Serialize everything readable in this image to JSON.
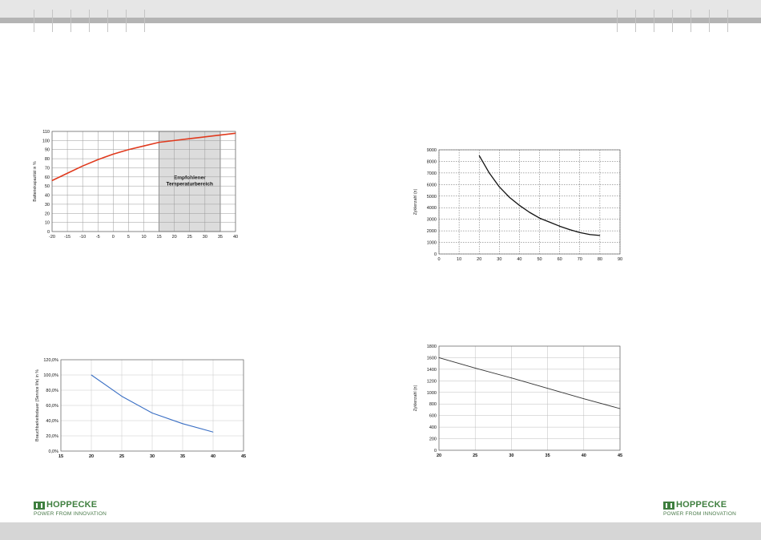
{
  "brand": {
    "logo_name": "HOPPECKE",
    "tagline": "POWER FROM INNOVATION",
    "green": "#3f7f3f"
  },
  "header": {
    "bar_color": "#b4b4b4"
  },
  "chart_data": [
    {
      "id": "capacity-vs-temperature",
      "type": "line",
      "ylabel": "Batteriekapazität in %",
      "xlim": [
        -20,
        40
      ],
      "ylim": [
        0,
        110
      ],
      "xticks": [
        "-20",
        "-15",
        "-10",
        "-5",
        "0",
        "5",
        "10",
        "15",
        "20",
        "25",
        "30",
        "35",
        "40"
      ],
      "yticks": [
        "0",
        "10",
        "20",
        "30",
        "40",
        "50",
        "60",
        "70",
        "80",
        "90",
        "100",
        "110"
      ],
      "shaded_region": {
        "x_from": 15,
        "x_to": 35,
        "label_line1": "Empfohlener",
        "label_line2": "Temperaturbereich"
      },
      "grid": true,
      "series": [
        {
          "x": [
            -20,
            -15,
            -10,
            -5,
            0,
            5,
            10,
            15,
            20,
            25,
            30,
            35,
            40
          ],
          "y": [
            56,
            64,
            72,
            79,
            85,
            90,
            94,
            98,
            100,
            102,
            104,
            106,
            108
          ],
          "color": "#e03a1e"
        }
      ]
    },
    {
      "id": "cycles-vs-dod",
      "type": "line",
      "ylabel": "Zyklenzahl (n)",
      "xlim": [
        0,
        90
      ],
      "ylim": [
        0,
        9000
      ],
      "xticks": [
        "0",
        "10",
        "20",
        "30",
        "40",
        "50",
        "60",
        "70",
        "80",
        "90"
      ],
      "yticks": [
        "0",
        "1000",
        "2000",
        "3000",
        "4000",
        "5000",
        "6000",
        "7000",
        "8000",
        "9000"
      ],
      "grid": true,
      "series": [
        {
          "x": [
            20,
            25,
            30,
            35,
            40,
            45,
            50,
            55,
            60,
            65,
            70,
            75,
            80
          ],
          "y": [
            8500,
            7000,
            5800,
            4900,
            4200,
            3600,
            3100,
            2750,
            2400,
            2100,
            1850,
            1680,
            1600
          ],
          "color": "#111111"
        }
      ]
    },
    {
      "id": "service-life-vs-temperature",
      "type": "line",
      "ylabel": "Brauchbarkeitsdauer (Service life) in %",
      "xlim": [
        15,
        45
      ],
      "ylim": [
        0,
        120
      ],
      "xticks": [
        "15",
        "20",
        "25",
        "30",
        "35",
        "40",
        "45"
      ],
      "yticks": [
        "0,0%",
        "20,0%",
        "40,0%",
        "60,0%",
        "80,0%",
        "100,0%",
        "120,0%"
      ],
      "grid": true,
      "series": [
        {
          "x": [
            20,
            25,
            30,
            35,
            40
          ],
          "y": [
            100,
            72,
            50,
            36,
            25
          ],
          "color": "#3a6fc4"
        }
      ]
    },
    {
      "id": "cycles-vs-temperature",
      "type": "line",
      "ylabel": "Zyklenzahl (n)",
      "xlim": [
        20,
        45
      ],
      "ylim": [
        0,
        1800
      ],
      "xticks": [
        "20",
        "25",
        "30",
        "35",
        "40",
        "45"
      ],
      "yticks": [
        "0",
        "200",
        "400",
        "600",
        "800",
        "1000",
        "1200",
        "1400",
        "1600",
        "1800"
      ],
      "grid": true,
      "series": [
        {
          "x": [
            20,
            25,
            30,
            35,
            40,
            45
          ],
          "y": [
            1600,
            1420,
            1250,
            1070,
            890,
            720
          ],
          "color": "#333333"
        }
      ]
    }
  ]
}
